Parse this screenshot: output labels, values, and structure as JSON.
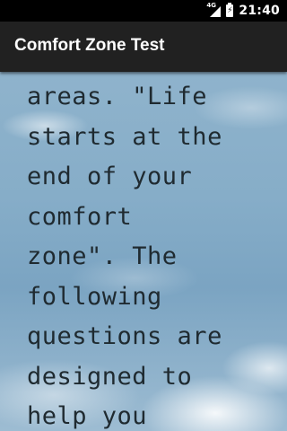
{
  "status_bar": {
    "network": "4G",
    "time": "21:40",
    "icons": [
      "signal-icon",
      "battery-charging-icon"
    ]
  },
  "app_bar": {
    "title": "Comfort Zone Test"
  },
  "content": {
    "text": "areas. \"Life\nstarts at the\nend of your\ncomfort\nzone\". The\nfollowing\nquestions are\ndesigned to\nhelp you"
  },
  "colors": {
    "status_bar": "#000000",
    "app_bar": "#212121",
    "sky": "#86adc8",
    "text": "#1f2a30"
  }
}
